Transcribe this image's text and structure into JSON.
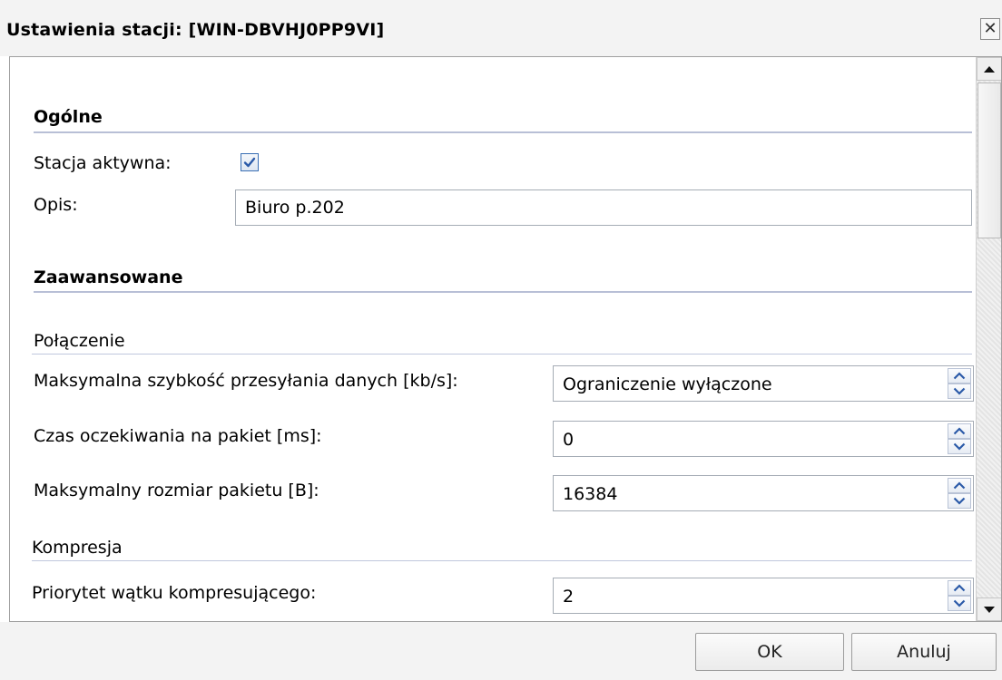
{
  "window": {
    "title": "Ustawienia stacji: [WIN-DBVHJ0PP9VI]",
    "close_glyph": "✕"
  },
  "general": {
    "title": "Ogólne",
    "active_label": "Stacja aktywna:",
    "active_checked": true,
    "description_label": "Opis:",
    "description_value": "Biuro p.202"
  },
  "advanced": {
    "title": "Zaawansowane",
    "connection": {
      "title": "Połączenie",
      "fields": [
        {
          "label": "Maksymalna szybkość przesyłania danych [kb/s]:",
          "value": "Ograniczenie wyłączone"
        },
        {
          "label": "Czas oczekiwania na pakiet [ms]:",
          "value": "0"
        },
        {
          "label": "Maksymalny rozmiar pakietu [B]:",
          "value": "16384"
        }
      ]
    },
    "compression": {
      "title": "Kompresja",
      "fields": [
        {
          "label": "Priorytet wątku kompresującego:",
          "value": "2"
        }
      ]
    }
  },
  "footer": {
    "ok_label": "OK",
    "cancel_label": "Anuluj"
  },
  "colors": {
    "section_line": "#b8bfd6",
    "checkbox_check": "#2b5aa8",
    "spinner_arrow": "#2b5aa8"
  }
}
